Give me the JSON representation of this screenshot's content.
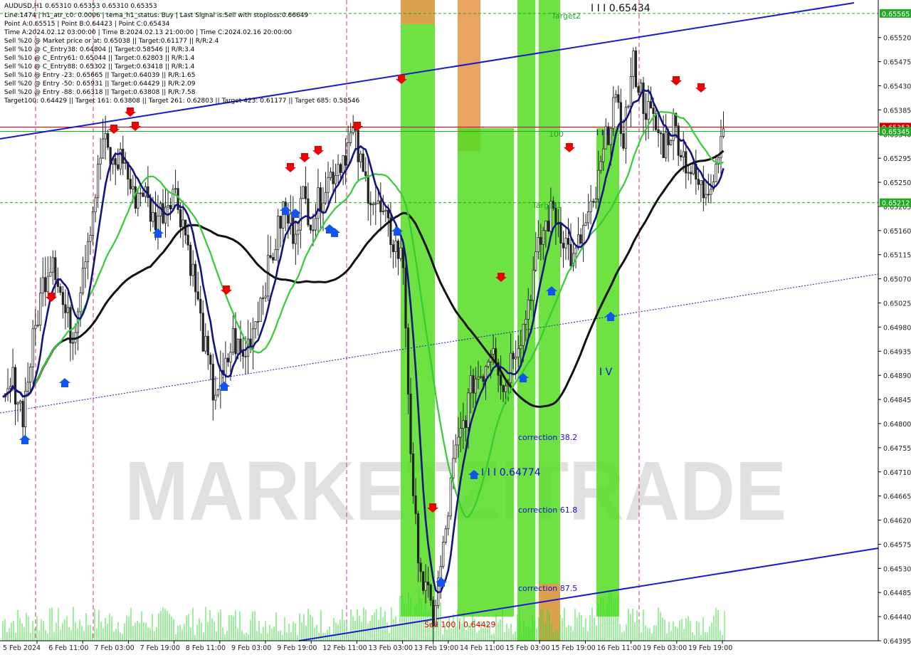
{
  "symbol_line": "AUDUSD,H1  0.65310 0.65353 0.65310 0.65353",
  "info_lines": [
    "Line:1474 | h1_atr_c0: 0.0006 | tema_h1_status: Buy | Last Signal is:Sell with stoploss:0.66649",
    "Point A:0.65515 | Point B:0.64423 | Point C:0.65434",
    "Time A:2024.02.12 03:00:00 | Time B:2024.02.13 21:00:00 | Time C:2024.02.16 20:00:00",
    "Sell %20 @ Market price or at: 0.65038 || Target:0.61177 || R/R:2.4",
    "Sell %10 @ C_Entry38: 0.64804 || Target:0.58546 || R/R:3.4",
    "Sell %10 @ C_Entry61: 0.65044 || Target:0.62803 || R/R:1.4",
    "Sell %10 @ C_Entry88: 0.65302 || Target:0.63418 || R/R:1.4",
    "Sell %10 @ Entry -23: 0.65665 || Target:0.64039 || R/R:1.65",
    "Sell %20 @ Entry -50: 0.65931 || Target:0.64429 || R/R:2.09",
    "Sell %20 @ Entry -88: 0.66318 || Target:0.63808 || R/R:7.58",
    "Target100: 0.64429 || Target 161: 0.63808 || Target 261: 0.62803 || Target 423: 0.61177 || Target 685: 0.58546"
  ],
  "watermark": "MARKETZITRADE",
  "chart_data": {
    "type": "candlestick",
    "symbol": "AUDUSD",
    "timeframe": "H1",
    "ylim": [
      0.64395,
      0.6559
    ],
    "y_ticks": [
      "0.65565",
      "0.65520",
      "0.65475",
      "0.65430",
      "0.65385",
      "0.65340",
      "0.65295",
      "0.65250",
      "0.65205",
      "0.65160",
      "0.65115",
      "0.65070",
      "0.65025",
      "0.64980",
      "0.64935",
      "0.64890",
      "0.64845",
      "0.64800",
      "0.64755",
      "0.64710",
      "0.64665",
      "0.64620",
      "0.64575",
      "0.64530",
      "0.64485",
      "0.64440",
      "0.64395"
    ],
    "x_ticks": [
      "5 Feb 2024",
      "6 Feb 11:00",
      "7 Feb 03:00",
      "7 Feb 19:00",
      "8 Feb 11:00",
      "9 Feb 03:00",
      "9 Feb 19:00",
      "12 Feb 11:00",
      "13 Feb 03:00",
      "13 Feb 19:00",
      "14 Feb 11:00",
      "15 Feb 03:00",
      "15 Feb 19:00",
      "16 Feb 11:00",
      "19 Feb 03:00",
      "19 Feb 19:00"
    ],
    "close_path": [
      0.6482,
      0.6488,
      0.6482,
      0.6495,
      0.6506,
      0.6512,
      0.6502,
      0.6496,
      0.651,
      0.652,
      0.6533,
      0.6528,
      0.653,
      0.6522,
      0.6524,
      0.6518,
      0.652,
      0.6524,
      0.6518,
      0.6508,
      0.6496,
      0.6486,
      0.6488,
      0.6496,
      0.6492,
      0.6498,
      0.6505,
      0.6512,
      0.652,
      0.6516,
      0.6522,
      0.6518,
      0.6524,
      0.6527,
      0.653,
      0.6534,
      0.6526,
      0.6522,
      0.6518,
      0.6514,
      0.651,
      0.6464,
      0.645,
      0.6444,
      0.6456,
      0.6472,
      0.648,
      0.6488,
      0.649,
      0.6496,
      0.6486,
      0.6494,
      0.6498,
      0.6508,
      0.6516,
      0.652,
      0.6515,
      0.651,
      0.6516,
      0.652,
      0.653,
      0.654,
      0.6534,
      0.6547,
      0.654,
      0.6536,
      0.6532,
      0.6536,
      0.653,
      0.6526,
      0.6523,
      0.6527,
      0.6535
    ],
    "price_lines": [
      {
        "label": "0.65565",
        "value": 0.65565,
        "color": "#22aa22",
        "style": "dashed"
      },
      {
        "label": "0.65353",
        "value": 0.65353,
        "color": "#cc0000",
        "style": "solid"
      },
      {
        "label": "0.65345",
        "value": 0.65345,
        "color": "#22aa22",
        "style": "solid"
      },
      {
        "label": "0.65212",
        "value": 0.65212,
        "color": "#22aa22",
        "style": "dashed"
      }
    ],
    "annotations": [
      {
        "text": "Target2",
        "color": "#22aa22"
      },
      {
        "text": "100",
        "color": "#22aa22"
      },
      {
        "text": "Target1",
        "color": "#22aa22"
      },
      {
        "text": "I I I 0.65434",
        "color": "#111111"
      },
      {
        "text": "I I I",
        "color": "#1111cc"
      },
      {
        "text": "I I I 0.64774",
        "color": "#1111cc"
      },
      {
        "text": "I V",
        "color": "#1111cc"
      },
      {
        "text": "correction 38.2",
        "color": "#1111cc"
      },
      {
        "text": "correction 61.8",
        "color": "#1111cc"
      },
      {
        "text": "correction 87.5",
        "color": "#1111cc"
      },
      {
        "text": "Sell 100 | 0.64429",
        "color": "#dd0000"
      }
    ],
    "colors": {
      "background": "#ffffff",
      "zone_green": "#55dd22",
      "zone_orange": "#e89a50",
      "channel": "#1a1acc",
      "ma_slow": "#111111",
      "ma_mid": "#141480",
      "ma_fast": "#33cc33",
      "sell_arrow": "#ee0000",
      "buy_arrow": "#1155ee",
      "volume": "#33dd33"
    }
  }
}
